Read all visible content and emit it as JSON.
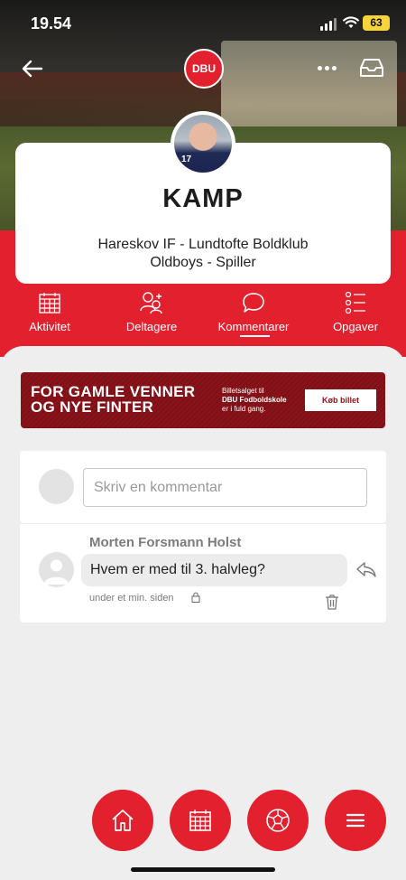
{
  "status_bar": {
    "time": "19.54",
    "battery": "63"
  },
  "header": {
    "logo_text": "DBU"
  },
  "event": {
    "title": "KAMP",
    "teams": "Hareskov IF - Lundtofte Boldklub",
    "role": "Oldboys - Spiller",
    "player_number": "17"
  },
  "tabs": [
    {
      "label": "Aktivitet",
      "icon": "calendar-icon"
    },
    {
      "label": "Deltagere",
      "icon": "participants-icon"
    },
    {
      "label": "Kommentarer",
      "icon": "chat-bubble-icon",
      "active": true
    },
    {
      "label": "Opgaver",
      "icon": "checklist-icon"
    }
  ],
  "banner": {
    "headline_1": "FOR GAMLE VENNER",
    "headline_2": "OG NYE FINTER",
    "sub_1": "Billetsalget til",
    "sub_2": "DBU Fodboldskole",
    "sub_3": "er i fuld gang.",
    "button": "Køb billet"
  },
  "comment_input": {
    "placeholder": "Skriv en kommentar"
  },
  "comments": [
    {
      "author": "Morten Forsmann Holst",
      "text": "Hvem er med til 3. halvleg?",
      "time": "under et min. siden"
    }
  ],
  "bottom_nav": [
    "home-icon",
    "calendar-icon",
    "football-icon",
    "menu-icon"
  ],
  "colors": {
    "primary_red": "#e3202e",
    "banner_dark_red": "#8a141b",
    "background": "#eeeeef"
  }
}
